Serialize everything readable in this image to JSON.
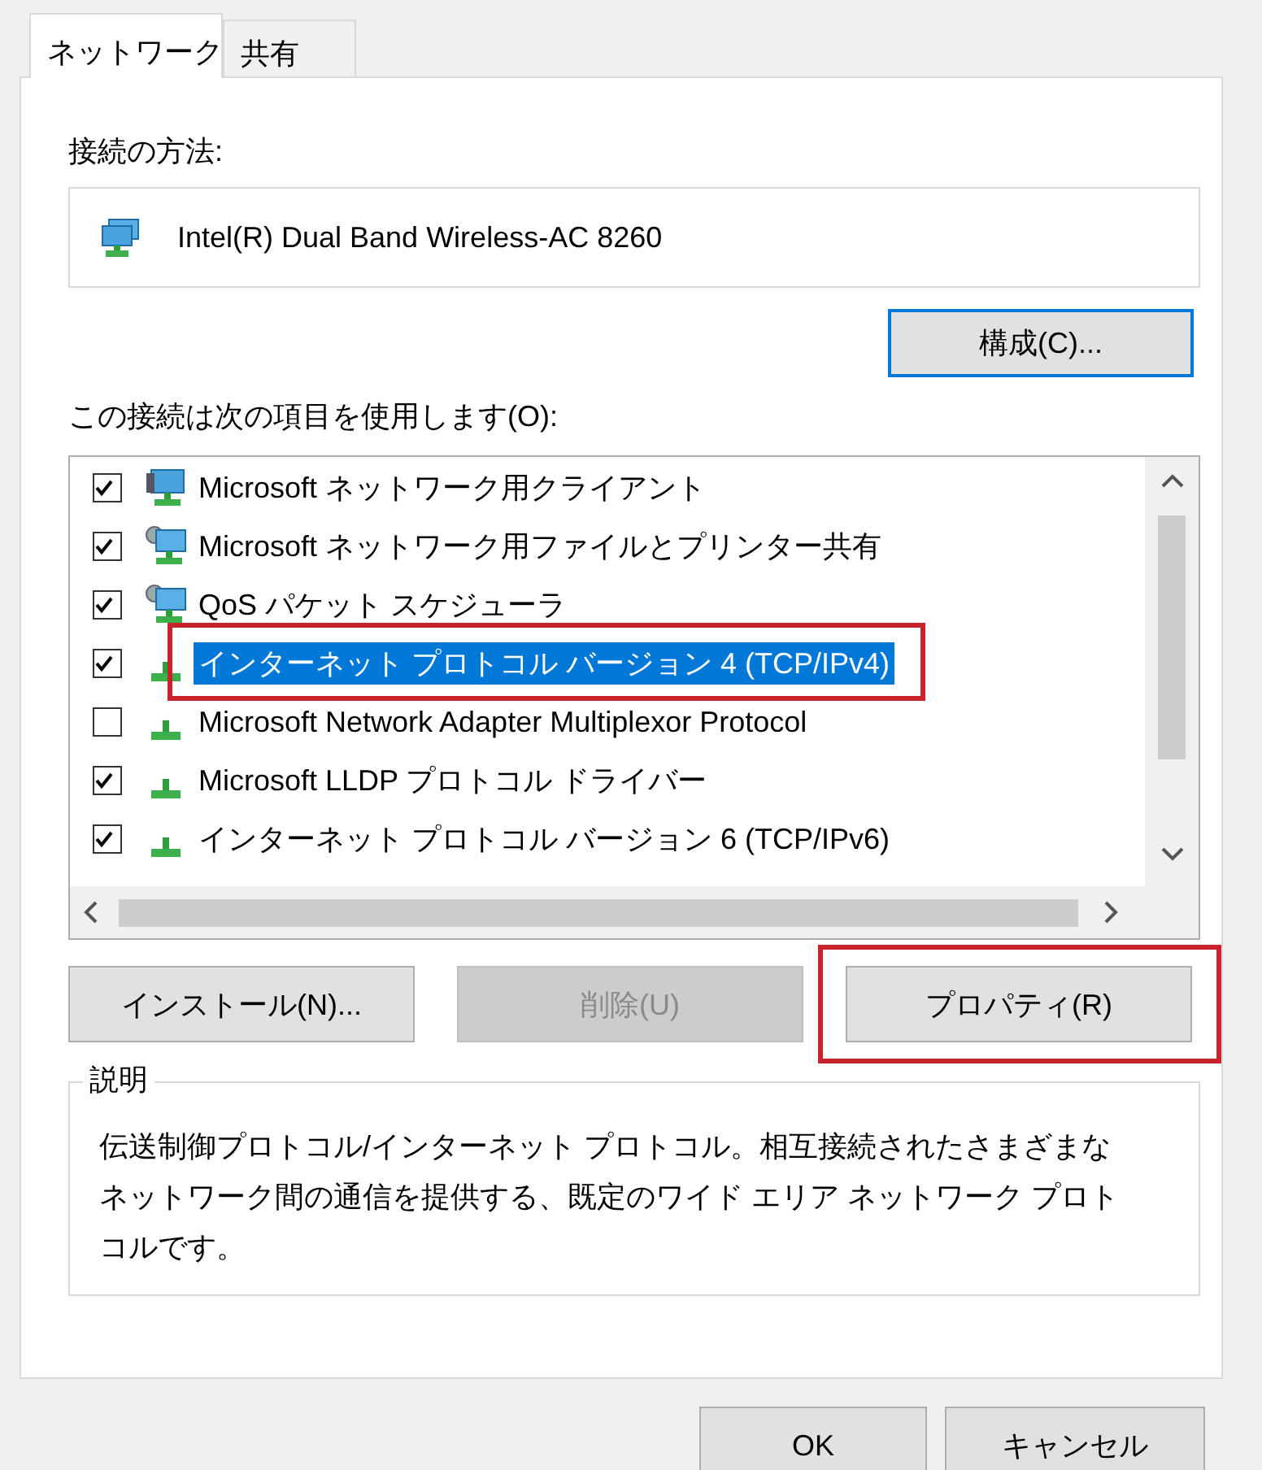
{
  "tabs": [
    {
      "label": "ネットワーク",
      "selected": true
    },
    {
      "label": "共有",
      "selected": false
    }
  ],
  "connect_using": {
    "label": "接続の方法:",
    "adapter": "Intel(R) Dual Band Wireless-AC 8260",
    "configure_button": {
      "label": "構成(C)...",
      "focused": true
    }
  },
  "items_label": "この接続は次の項目を使用します(O):",
  "items": [
    {
      "kind": "client",
      "label": "Microsoft ネットワーク用クライアント",
      "checked": true,
      "selected": false,
      "highlighted": false
    },
    {
      "kind": "service",
      "label": "Microsoft ネットワーク用ファイルとプリンター共有",
      "checked": true,
      "selected": false,
      "highlighted": false
    },
    {
      "kind": "service",
      "label": "QoS パケット スケジューラ",
      "checked": true,
      "selected": false,
      "highlighted": false
    },
    {
      "kind": "protocol",
      "label": "インターネット プロトコル バージョン 4 (TCP/IPv4)",
      "checked": true,
      "selected": true,
      "highlighted": true
    },
    {
      "kind": "protocol",
      "label": "Microsoft Network Adapter Multiplexor Protocol",
      "checked": false,
      "selected": false,
      "highlighted": false
    },
    {
      "kind": "protocol",
      "label": "Microsoft LLDP プロトコル ドライバー",
      "checked": true,
      "selected": false,
      "highlighted": false
    },
    {
      "kind": "protocol",
      "label": "インターネット プロトコル バージョン 6 (TCP/IPv6)",
      "checked": true,
      "selected": false,
      "highlighted": false
    }
  ],
  "item_buttons": [
    {
      "label": "インストール(N)...",
      "disabled": false,
      "highlighted": false
    },
    {
      "label": "削除(U)",
      "disabled": true,
      "highlighted": false
    },
    {
      "label": "プロパティ(R)",
      "disabled": false,
      "highlighted": true
    }
  ],
  "description": {
    "title": "説明",
    "text": "伝送制御プロトコル/インターネット プロトコル。相互接続されたさまざまなネットワーク間の通信を提供する、既定のワイド エリア ネットワーク プロトコルです。"
  },
  "dialog_buttons": [
    {
      "label": "OK"
    },
    {
      "label": "キャンセル"
    }
  ]
}
